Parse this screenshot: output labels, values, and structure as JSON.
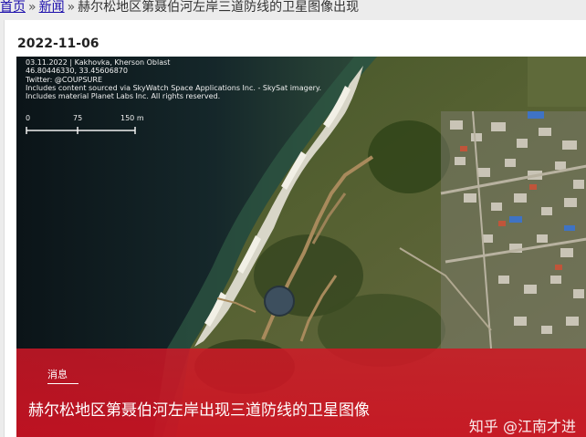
{
  "breadcrumb": {
    "home": "首页",
    "separator": "»",
    "section": "新闻",
    "current": "赫尔松地区第聂伯河左岸三道防线的卫星图像出现"
  },
  "article": {
    "date": "2022-11-06",
    "tag": "消息",
    "headline": "赫尔松地区第聂伯河左岸出现三道防线的卫星图像"
  },
  "image_metadata": {
    "line1": "03.11.2022 | Kakhovka, Kherson Oblast",
    "line2": "46.80446330, 33.45606870",
    "line3": "Twitter: @COUPSURE",
    "line4": "Includes content sourced via SkyWatch Space Applications Inc. - SkySat imagery.",
    "line5": "Includes material Planet Labs Inc. All rights reserved."
  },
  "scale": {
    "tick0": "0",
    "tick1": "75",
    "tick2": "150 m"
  },
  "watermark": "知乎 @江南才进",
  "colors": {
    "overlay_red": "#d61626",
    "link_blue": "#1a0dab",
    "water_dark": "#0e1a20",
    "land_olive": "#4a5a2c"
  }
}
